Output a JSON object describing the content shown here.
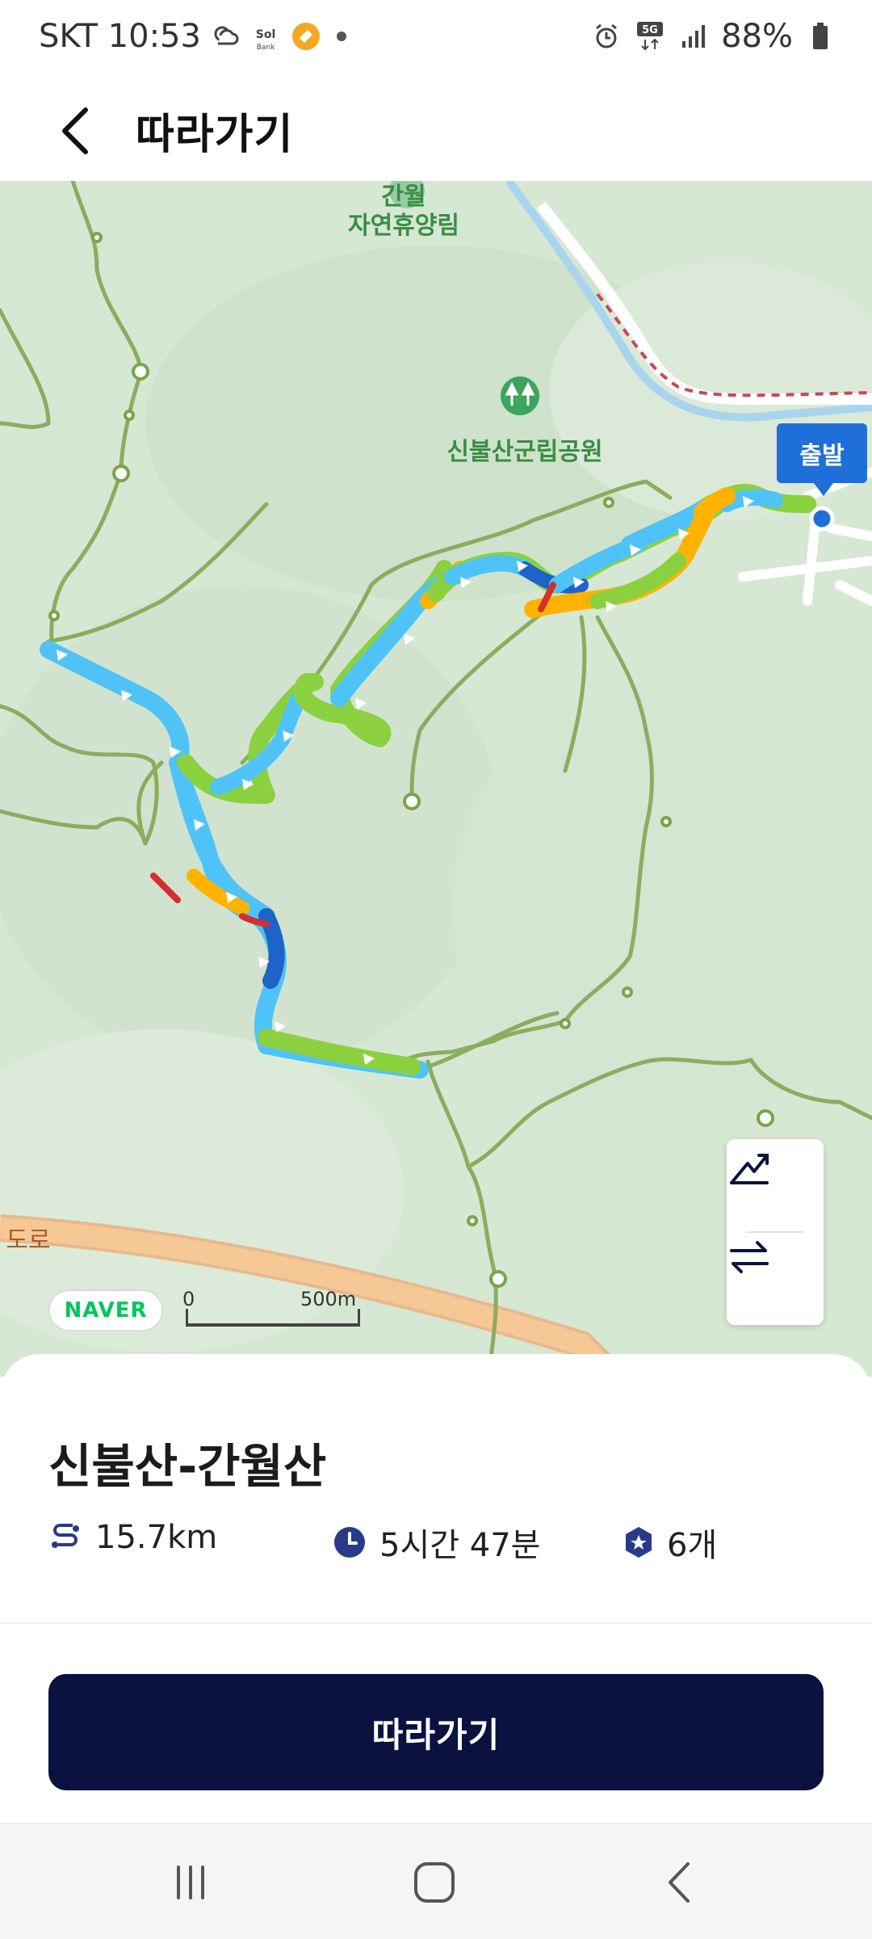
{
  "status_bar": {
    "carrier_time": "SKT 10:53",
    "app_badge": "Sol",
    "battery": "88%"
  },
  "header": {
    "title": "따라가기",
    "back_icon": "chevron-left-icon"
  },
  "map": {
    "labels": {
      "forest": "간월\n자연휴양림",
      "park": "신불산군립공원",
      "road": "도로"
    },
    "start_label": "출발",
    "naver": "NAVER",
    "scale_zero": "0",
    "scale_distance": "500m",
    "controls": [
      "elevation-icon",
      "swap-direction-icon"
    ],
    "route_colors": [
      "#4fc3f7",
      "#8bd13f",
      "#ffb300",
      "#1e63c7",
      "#d32f2f"
    ]
  },
  "course": {
    "title": "신불산-간월산",
    "distance": "15.7km",
    "duration": "5시간 47분",
    "checkpoints": "6개"
  },
  "actions": {
    "follow_label": "따라가기"
  },
  "nav_bar": {
    "buttons": [
      "recent-apps-icon",
      "home-icon",
      "back-icon"
    ]
  }
}
